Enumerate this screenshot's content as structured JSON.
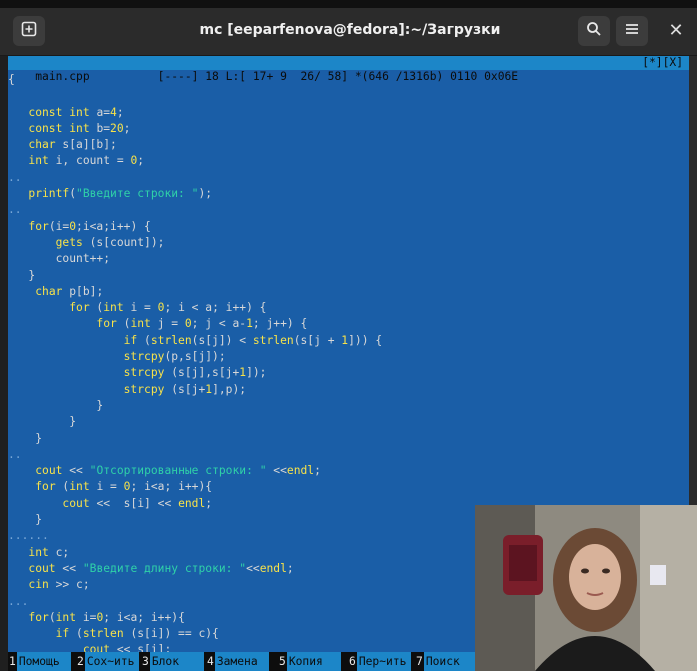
{
  "window": {
    "title": "mc [eeparfenova@fedora]:~/Загрузки"
  },
  "titlebar": {
    "new_tab_icon": "plus-square-icon",
    "search_icon": "search-icon",
    "menu_icon": "hamburger-menu-icon",
    "close_icon": "close-icon"
  },
  "status": {
    "left": "main.cpp          [----] 18 L:[ 17+ 9  26/ 58] *(646 /1316b) 0110 0x06E",
    "right": "[*][X]"
  },
  "code_lines": [
    "{",
    "",
    "   const int a=4;",
    "   const int b=20;",
    "   char s[a][b];",
    "   int i, count = 0;",
    "..",
    "   printf(\"Введите строки: \");",
    "..",
    "   for(i=0;i<a;i++) {",
    "       gets (s[count]);",
    "       count++;",
    "   }",
    "    char p[b];",
    "         for (int i = 0; i < a; i++) {",
    "             for (int j = 0; j < a-1; j++) {",
    "                 if (strlen(s[j]) < strlen(s[j + 1])) {",
    "                 strcpy(p,s[j]);",
    "                 strcpy (s[j],s[j+1]);",
    "                 strcpy (s[j+1],p);",
    "             }",
    "         }",
    "    }",
    "..",
    "    cout << \"Отсортированные строки: \" <<endl;",
    "    for (int i = 0; i<a; i++){",
    "        cout <<  s[i] << endl;",
    "    }",
    "......",
    "   int c;",
    "   cout << \"Введите длину строки: \"<<endl;",
    "   cin >> c;",
    "...",
    "   for(int i=0; i<a; i++){",
    "       if (strlen (s[i]) == c){",
    "           cout << s[i];",
    "       },"
  ],
  "fkeys": [
    {
      "num": "1",
      "label": "Помощь"
    },
    {
      "num": "2",
      "label": "Сох~ить"
    },
    {
      "num": "3",
      "label": "Блок"
    },
    {
      "num": "4",
      "label": "Замена"
    },
    {
      "num": "5",
      "label": "Копия"
    },
    {
      "num": "6",
      "label": "Пер~ить"
    },
    {
      "num": "7",
      "label": "Поиск"
    }
  ],
  "colors": {
    "editor_bg": "#1a5ea7",
    "keyword": "#f7e24a",
    "string": "#2fd1a8",
    "status_bg": "#1c86c8"
  }
}
